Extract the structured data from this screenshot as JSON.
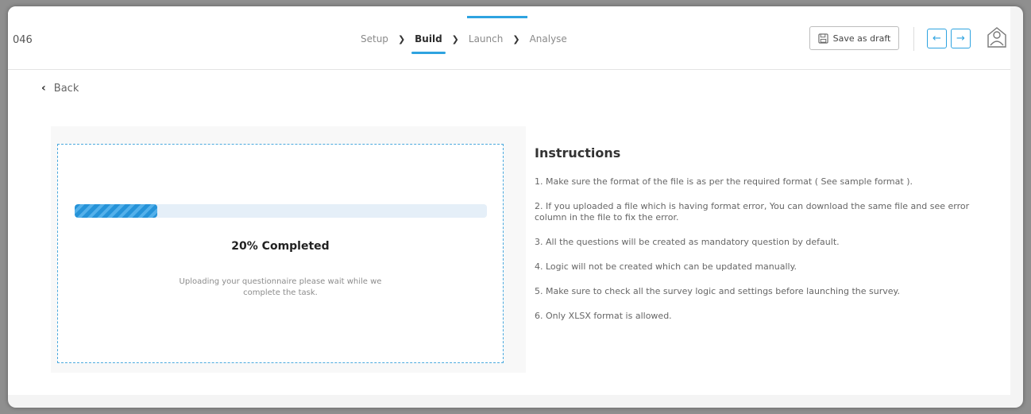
{
  "header": {
    "survey_id": "046",
    "steps": [
      "Setup",
      "Build",
      "Launch",
      "Analyse"
    ],
    "active_step": "Build",
    "save_draft_label": "Save as draft"
  },
  "back_label": "Back",
  "upload": {
    "progress_percent": 20,
    "progress_text": "20% Completed",
    "message": "Uploading your questionnaire please wait while we complete the task."
  },
  "instructions": {
    "title": "Instructions",
    "items": [
      "1. Make sure the format of the file is as per the required format ( See sample format ).",
      "2. If you uploaded a file which is having format error, You can download the same file and see error column in the file to fix the error.",
      "3. All the questions will be created as mandatory question by default.",
      "4. Logic will not be created which can be updated manually.",
      "5. Make sure to check all the survey logic and settings before launching the survey.",
      "6. Only XLSX format is allowed."
    ]
  },
  "icons": {
    "back": "chevron-left-icon",
    "save": "save-icon",
    "prev": "arrow-left-icon",
    "next": "arrow-right-icon",
    "user": "user-profile-icon"
  },
  "colors": {
    "accent": "#2ea3e0",
    "progress": "#2693d8"
  }
}
